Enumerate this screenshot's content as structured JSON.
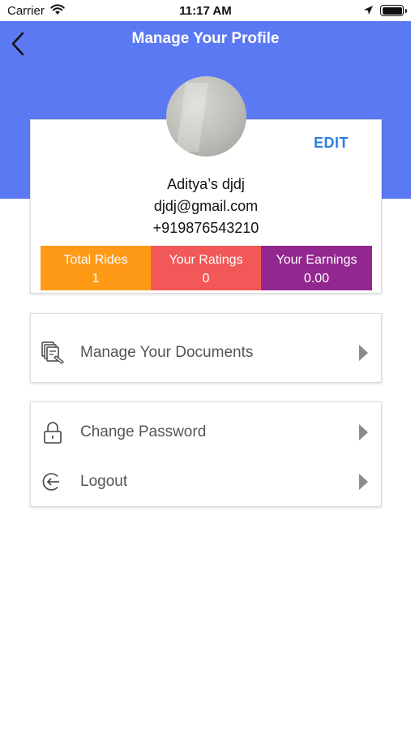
{
  "status_bar": {
    "carrier": "Carrier",
    "time": "11:17 AM"
  },
  "header": {
    "title": "Manage Your Profile",
    "color": "#5b79f2"
  },
  "profile": {
    "edit_label": "EDIT",
    "name": "Aditya’s djdj",
    "email": "djdj@gmail.com",
    "phone": "+919876543210",
    "stats": [
      {
        "label": "Total Rides",
        "value": "1",
        "color": "#ff9a17"
      },
      {
        "label": "Your Ratings",
        "value": "0",
        "color": "#f25857"
      },
      {
        "label": "Your Earnings",
        "value": "0.00",
        "color": "#92278f"
      }
    ]
  },
  "menu": {
    "documents": {
      "label": "Manage Your Documents",
      "icon": "documents-icon"
    },
    "change_password": {
      "label": "Change Password",
      "icon": "lock-icon"
    },
    "logout": {
      "label": "Logout",
      "icon": "logout-icon"
    }
  },
  "icons": {
    "back": "chevron-left-icon",
    "arrow": "triangle-right-icon",
    "wifi": "wifi-icon",
    "location": "location-arrow-icon",
    "battery": "battery-icon"
  }
}
